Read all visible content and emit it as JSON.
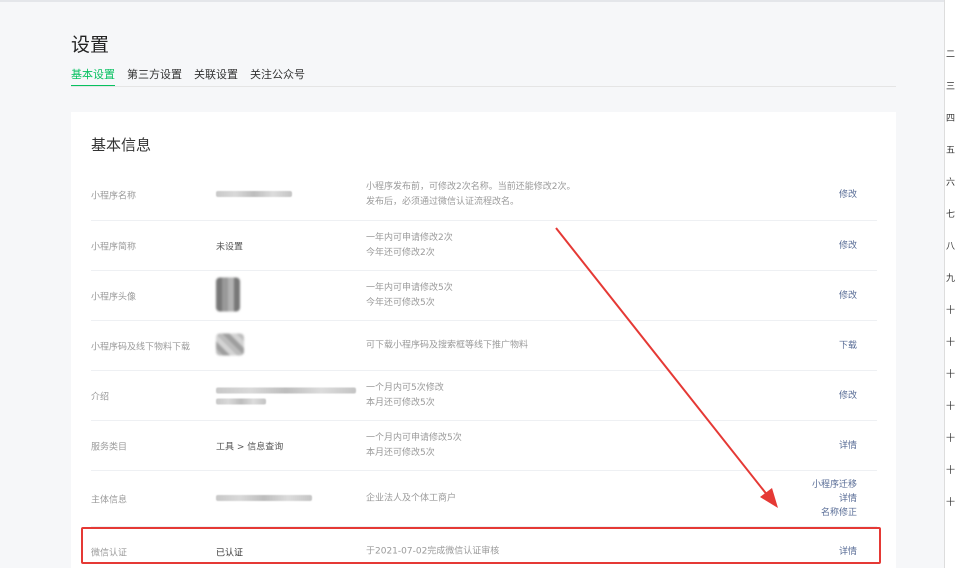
{
  "page": {
    "title": "设置"
  },
  "tabs": [
    {
      "label": "基本设置",
      "active": true
    },
    {
      "label": "第三方设置",
      "active": false
    },
    {
      "label": "关联设置",
      "active": false
    },
    {
      "label": "关注公众号",
      "active": false
    }
  ],
  "card": {
    "title": "基本信息",
    "rows": [
      {
        "label": "小程序名称",
        "value": "",
        "desc": [
          "小程序发布前，可修改2次名称。当前还能修改2次。",
          "发布后，必须通过微信认证流程改名。"
        ],
        "actions": [
          "修改"
        ]
      },
      {
        "label": "小程序简称",
        "value": "未设置",
        "desc": [
          "一年内可申请修改2次",
          "今年还可修改2次"
        ],
        "actions": [
          "修改"
        ]
      },
      {
        "label": "小程序头像",
        "value": "",
        "desc": [
          "一年内可申请修改5次",
          "今年还可修改5次"
        ],
        "actions": [
          "修改"
        ]
      },
      {
        "label": "小程序码及线下物料下载",
        "value": "",
        "desc": [
          "可下载小程序码及搜索框等线下推广物料"
        ],
        "actions": [
          "下载"
        ]
      },
      {
        "label": "介绍",
        "value": "",
        "desc": [
          "一个月内可5次修改",
          "本月还可修改5次"
        ],
        "actions": [
          "修改"
        ]
      },
      {
        "label": "服务类目",
        "value": "工具 > 信息查询",
        "desc": [
          "一个月内可申请修改5次",
          "本月还可修改5次"
        ],
        "actions": [
          "详情"
        ]
      },
      {
        "label": "主体信息",
        "value": "",
        "desc": [
          "企业法人及个体工商户"
        ],
        "actions": [
          "小程序迁移",
          "详情",
          "名称修正"
        ]
      },
      {
        "label": "微信认证",
        "value": "已认证",
        "desc": [
          "于2021-07-02完成微信认证审核"
        ],
        "actions": [
          "详情"
        ]
      }
    ]
  },
  "sidebar": {
    "marks": [
      "二",
      "三",
      "四",
      "五",
      "六",
      "七",
      "八",
      "九",
      "十",
      "十",
      "十",
      "十",
      "十",
      "十",
      "十"
    ]
  },
  "colors": {
    "accent": "#07c160",
    "link": "#576b95",
    "highlight": "#e53935"
  }
}
